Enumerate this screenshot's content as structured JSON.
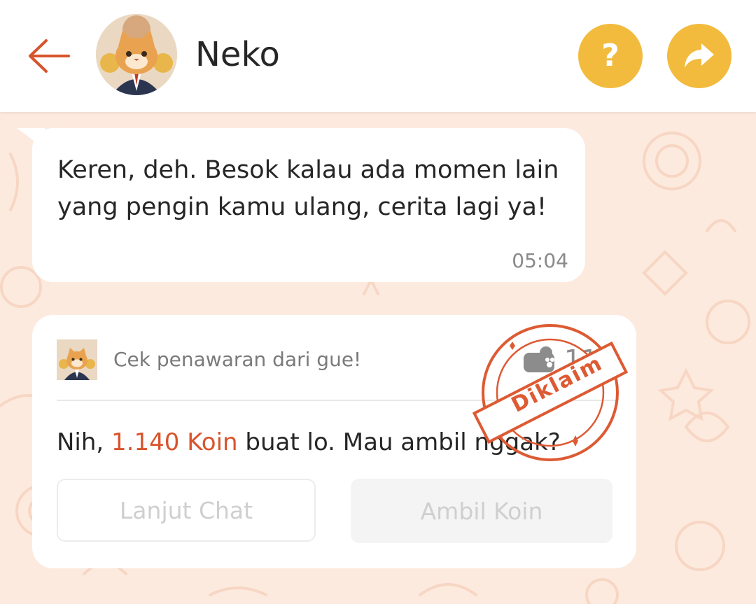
{
  "header": {
    "title": "Neko",
    "help_label": "?"
  },
  "messages": [
    {
      "text": "Keren, deh. Besok kalau ada momen lain yang pengin kamu ulang, cerita lagi ya!",
      "time": "05:04"
    }
  ],
  "offer": {
    "header_text": "Cek penawaran dari gue!",
    "coin_count": "114",
    "message_prefix": "Nih, ",
    "message_highlight": "1.140 Koin",
    "message_suffix": " buat lo. Mau ambil nggak?",
    "continue_label": "Lanjut Chat",
    "claim_label": "Ambil Koin",
    "stamp_label": "Diklaim"
  },
  "colors": {
    "accent": "#f2bb3d",
    "highlight": "#d8542c",
    "back_arrow": "#d8542c",
    "background": "#fdeadf"
  },
  "icons": {
    "back": "arrow-left-icon",
    "help": "question-icon",
    "share": "share-arrow-icon",
    "coin": "paw-coin-icon"
  }
}
